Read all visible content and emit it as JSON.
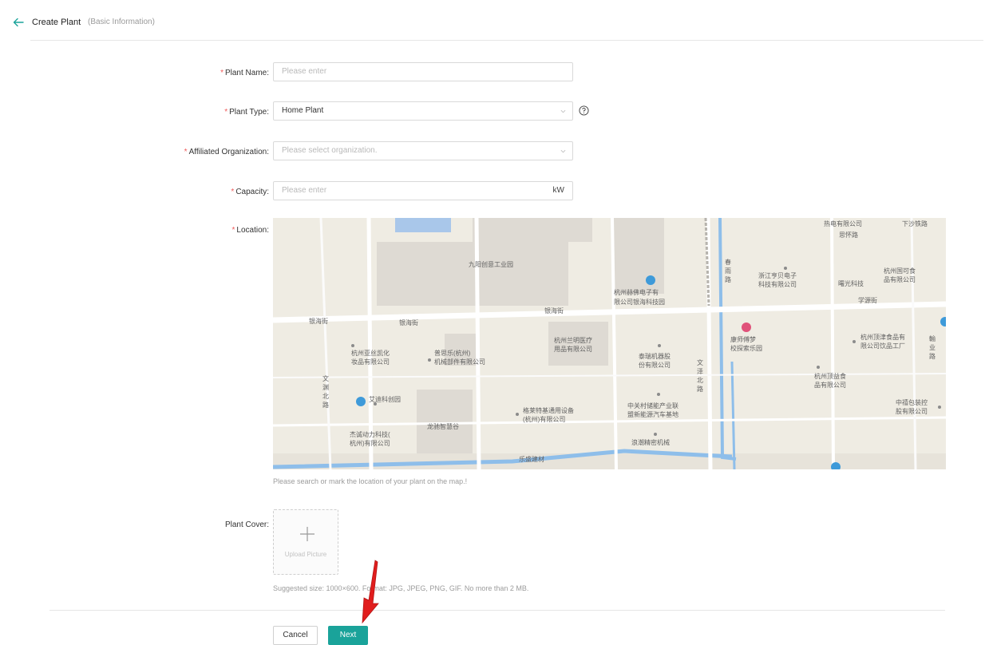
{
  "header": {
    "title": "Create Plant",
    "subtitle": "(Basic Information)"
  },
  "form": {
    "plant_name": {
      "label": "Plant Name:",
      "placeholder": "Please enter"
    },
    "plant_type": {
      "label": "Plant Type:",
      "value": "Home Plant"
    },
    "organization": {
      "label": "Affiliated Organization:",
      "placeholder": "Please select organization."
    },
    "capacity": {
      "label": "Capacity:",
      "placeholder": "Please enter",
      "unit": "kW"
    },
    "location": {
      "label": "Location:",
      "hint": "Please search or mark the location of your plant on the map.!"
    },
    "plant_cover": {
      "label": "Plant Cover:",
      "upload_label": "Upload Picture",
      "hint": "Suggested size: 1000×600. Format: JPG, JPEG, PNG, GIF. No more than 2 MB."
    }
  },
  "map": {
    "labels": [
      "九阳创意工业园",
      "杭州赫佛电子有",
      "限公司银海科技园",
      "银海街",
      "银海街",
      "银海街",
      "浙江亨贝电子",
      "科技有限公司",
      "杭州国可食",
      "品有限公司",
      "曙光科技",
      "杭州亚丝凯化",
      "妆品有限公司",
      "普思乐(杭州)",
      "机械部件有限公司",
      "杭州兰明医疗",
      "用品有限公司",
      "泰瑞机器股",
      "份有限公司",
      "康师傅梦",
      "校探索乐园",
      "杭州顶津食品有",
      "限公司饮品工厂",
      "杭州顶益食",
      "品有限公司",
      "艾迪科创园",
      "龙驰智慧谷",
      "格莱特基通用设备",
      "(杭州)有限公司",
      "中关村储能产业联",
      "盟新能源汽车基地",
      "中禧包装控",
      "股有限公司",
      "杰诚动力科技(",
      "杭州)有限公司",
      "浪潮精密机械",
      "乐盛建材",
      "文渊北路",
      "文泽北路",
      "春雨路",
      "思怀路",
      "热电有限公司",
      "下沙铁路",
      "学源街",
      "輸业路"
    ]
  },
  "actions": {
    "cancel": "Cancel",
    "next": "Next"
  },
  "colors": {
    "primary": "#1aa39a",
    "required": "#ef5a5a",
    "annotation_arrow": "#e11d1d"
  }
}
